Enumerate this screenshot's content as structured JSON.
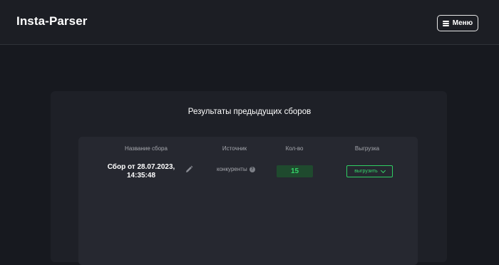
{
  "header": {
    "brand": "Insta-Parser",
    "menu_label": "Меню"
  },
  "results": {
    "title": "Результаты предыдущих сборов",
    "columns": [
      "Название сбора",
      "Источник",
      "Кол-во",
      "Выгрузка"
    ],
    "rows": [
      {
        "name_line1": "Сбор от 28.07.2023,",
        "name_line2": "14:35:48",
        "source": "конкуренты",
        "count": "15",
        "export_label": "выгрузить"
      }
    ]
  },
  "colors": {
    "background": "#17191f",
    "panel": "#1e2027",
    "card": "#262830",
    "accent_green": "#35d46a"
  },
  "icons": [
    "hamburger-icon",
    "pencil-icon",
    "help-icon",
    "chevron-down-icon"
  ]
}
